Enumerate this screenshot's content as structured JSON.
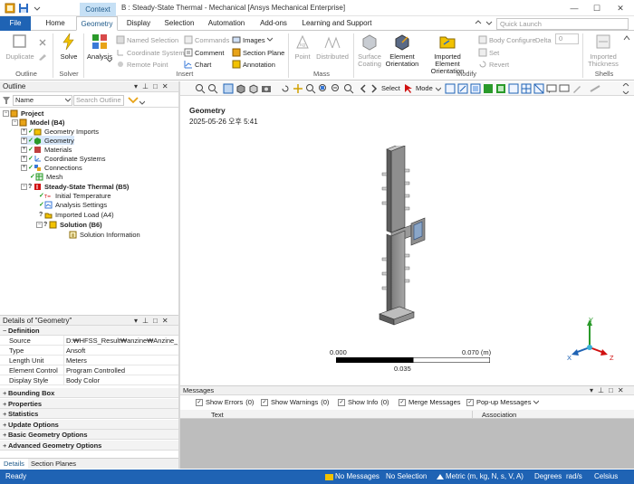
{
  "window": {
    "context_tab": "Context",
    "title": "B : Steady-State Thermal - Mechanical [Ansys Mechanical Enterprise]",
    "minimize": "—",
    "maximize": "☐",
    "close": "✕"
  },
  "ribbon_tabs": [
    "File",
    "Home",
    "Geometry",
    "Display",
    "Selection",
    "Automation",
    "Add-ons",
    "Learning and Support"
  ],
  "quick_launch": {
    "placeholder": "Quick Launch"
  },
  "ribbon": {
    "duplicate": "Duplicate",
    "solve": "Solve",
    "analysis": "Analysis",
    "named_selection": "Named Selection",
    "coordinate_system": "Coordinate System",
    "remote_point": "Remote Point",
    "commands": "Commands",
    "comment": "Comment",
    "chart": "Chart",
    "images": "Images",
    "section_plane": "Section Plane",
    "annotation": "Annotation",
    "point": "Point",
    "distributed": "Distributed",
    "surface_coating": [
      "Surface",
      "Coating"
    ],
    "element_orientation": [
      "Element",
      "Orientation"
    ],
    "imported_element_orientation": [
      "Imported Element",
      "Orientation"
    ],
    "body_configure": "Body Configure",
    "delta": "Delta",
    "delta_value": "0",
    "set": "Set",
    "revert": "Revert",
    "imported_thickness": [
      "Imported",
      "Thickness"
    ],
    "groups": {
      "outline": "Outline",
      "solver": "Solver",
      "insert": "Insert",
      "mass": "Mass",
      "modify": "Modify",
      "shells": "Shells"
    }
  },
  "outline": {
    "title": "Outline",
    "name_filter": "Name",
    "search_placeholder": "Search Outline",
    "tree": {
      "project": "Project",
      "model": "Model (B4)",
      "geometry_imports": "Geometry Imports",
      "geometry": "Geometry",
      "materials": "Materials",
      "coordinate_systems": "Coordinate Systems",
      "connections": "Connections",
      "mesh": "Mesh",
      "steady_state_thermal": "Steady-State Thermal (B5)",
      "initial_temperature": "Initial Temperature",
      "analysis_settings": "Analysis Settings",
      "imported_load": "Imported Load (A4)",
      "solution": "Solution (B6)",
      "solution_information": "Solution Information"
    }
  },
  "details": {
    "title": "Details of \"Geometry\"",
    "definition": "Definition",
    "rows": [
      {
        "key": "Source",
        "value": "D:₩HFSS_Result₩anzine₩Anzine_Dipl..."
      },
      {
        "key": "Type",
        "value": "Ansoft"
      },
      {
        "key": "Length Unit",
        "value": "Meters"
      },
      {
        "key": "Element Control",
        "value": "Program Controlled"
      },
      {
        "key": "Display Style",
        "value": "Body Color"
      }
    ],
    "sections": [
      "Bounding Box",
      "Properties",
      "Statistics",
      "Update Options",
      "Basic Geometry Options",
      "Advanced Geometry Options"
    ],
    "tabs": [
      "Details",
      "Section Planes"
    ]
  },
  "viewport": {
    "toolbar_select": "Select",
    "toolbar_mode": "Mode",
    "heading": "Geometry",
    "date": "2025-05-26 오후 5:41",
    "scale_left": "0.000",
    "scale_right": "0.070 (m)",
    "scale_mid": "0.035",
    "triad": {
      "x": "X",
      "y": "Y",
      "z": "Z"
    }
  },
  "messages": {
    "title": "Messages",
    "show_errors": "Show Errors",
    "errors_count": "(0)",
    "show_warnings": "Show Warnings",
    "warnings_count": "(0)",
    "show_info": "Show Info",
    "info_count": "(0)",
    "merge_messages": "Merge Messages",
    "popup_messages": "Pop-up Messages",
    "col_text": "Text",
    "col_association": "Association"
  },
  "status": {
    "ready": "Ready",
    "no_messages": "No Messages",
    "no_selection": "No Selection",
    "units": "Metric (m, kg, N, s, V, A)",
    "degrees": "Degrees",
    "rads": "rad/s",
    "celsius": "Celsius"
  },
  "colors": {
    "accent": "#1f63b4",
    "context": "#c6e0f5",
    "model": "#8e8e8e",
    "triad_x": "#1f63b4",
    "triad_y": "#2a9a2a",
    "triad_z": "#d01010"
  }
}
